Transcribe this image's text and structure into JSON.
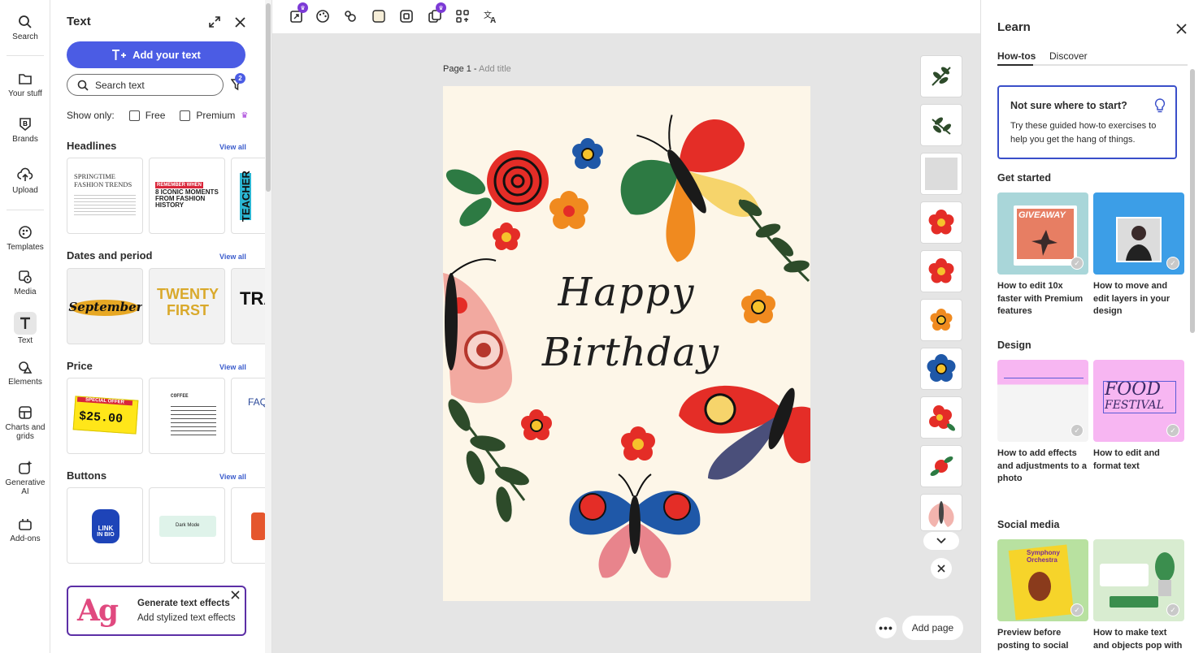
{
  "rail": {
    "items": [
      {
        "label": "Search",
        "icon": "search-icon"
      },
      {
        "label": "Your stuff",
        "icon": "folder-icon"
      },
      {
        "label": "Brands",
        "icon": "brand-icon"
      },
      {
        "label": "Upload",
        "icon": "upload-icon"
      },
      {
        "label": "Templates",
        "icon": "templates-icon"
      },
      {
        "label": "Media",
        "icon": "media-icon"
      },
      {
        "label": "Text",
        "icon": "text-icon"
      },
      {
        "label": "Elements",
        "icon": "elements-icon"
      },
      {
        "label": "Charts and grids",
        "label_line1": "Charts and",
        "label_line2": "grids",
        "icon": "charts-icon"
      },
      {
        "label": "Generative AI",
        "label_line1": "Generative",
        "label_line2": "AI",
        "icon": "generative-ai-icon"
      },
      {
        "label": "Add-ons",
        "icon": "addons-icon"
      }
    ],
    "active": "Text"
  },
  "text_panel": {
    "title": "Text",
    "add_text_label": "Add your text",
    "search_placeholder": "Search text",
    "filter_count": "2",
    "show_only_label": "Show only:",
    "free_label": "Free",
    "premium_label": "Premium",
    "sections": [
      {
        "title": "Headlines",
        "view_all": "View all"
      },
      {
        "title": "Dates and period",
        "view_all": "View all"
      },
      {
        "title": "Price",
        "view_all": "View all"
      },
      {
        "title": "Buttons",
        "view_all": "View all"
      }
    ],
    "headline_thumbs": {
      "t1_line1": "SPRINGTIME",
      "t1_line2": "FASHION TRENDS",
      "t2_tag": "REMEMBER WHEN",
      "t2_line1": "8 ICONIC MOMENTS",
      "t2_line2": "FROM FASHION",
      "t2_line3": "HISTORY",
      "t3": "TEACHER"
    },
    "date_thumbs": {
      "d1": "September",
      "d2_line1": "TWENTY",
      "d2_line2": "FIRST",
      "d3": "TRA"
    },
    "price_thumbs": {
      "p1_tag": "SPECIAL OFFER",
      "p1_price": "$25.00",
      "p2_title": "COFFEE",
      "p3": "FAQ"
    },
    "button_thumbs": {
      "b1_line1": "LINK",
      "b1_line2": "IN BIO",
      "b2": "Dark Mode"
    },
    "gen_effects": {
      "preview": "Ag",
      "title": "Generate text effects",
      "subtitle": "Add stylized text effects"
    }
  },
  "canvas": {
    "page_label": "Page 1 - ",
    "add_title": "Add title",
    "card_line1": "Happy",
    "card_line2": "Birthday",
    "add_page_label": "Add page"
  },
  "learn": {
    "title": "Learn",
    "tabs": [
      "How-tos",
      "Discover"
    ],
    "start_title": "Not sure where to start?",
    "start_body": "Try these guided how-to exercises to help you get the hang of things.",
    "sections": [
      "Get started",
      "Design",
      "Social media"
    ],
    "cards": [
      {
        "text": "How to edit 10x faster with Premium features",
        "img_text": "GIVEAWAY"
      },
      {
        "text": "How to move and edit layers in your design"
      },
      {
        "text": "How to add effects and adjustments to a photo"
      },
      {
        "text": "How to edit and format text",
        "img_text_1": "FOOD",
        "img_text_2": "FESTIVAL"
      },
      {
        "text": "Preview before posting to social",
        "img_text": "Symphony Orchestra"
      },
      {
        "text": "How to make text and objects pop with"
      }
    ]
  },
  "colors": {
    "accent": "#4b5ce4",
    "premium": "#a53bd9",
    "card_bg": "#fdf6e8"
  }
}
